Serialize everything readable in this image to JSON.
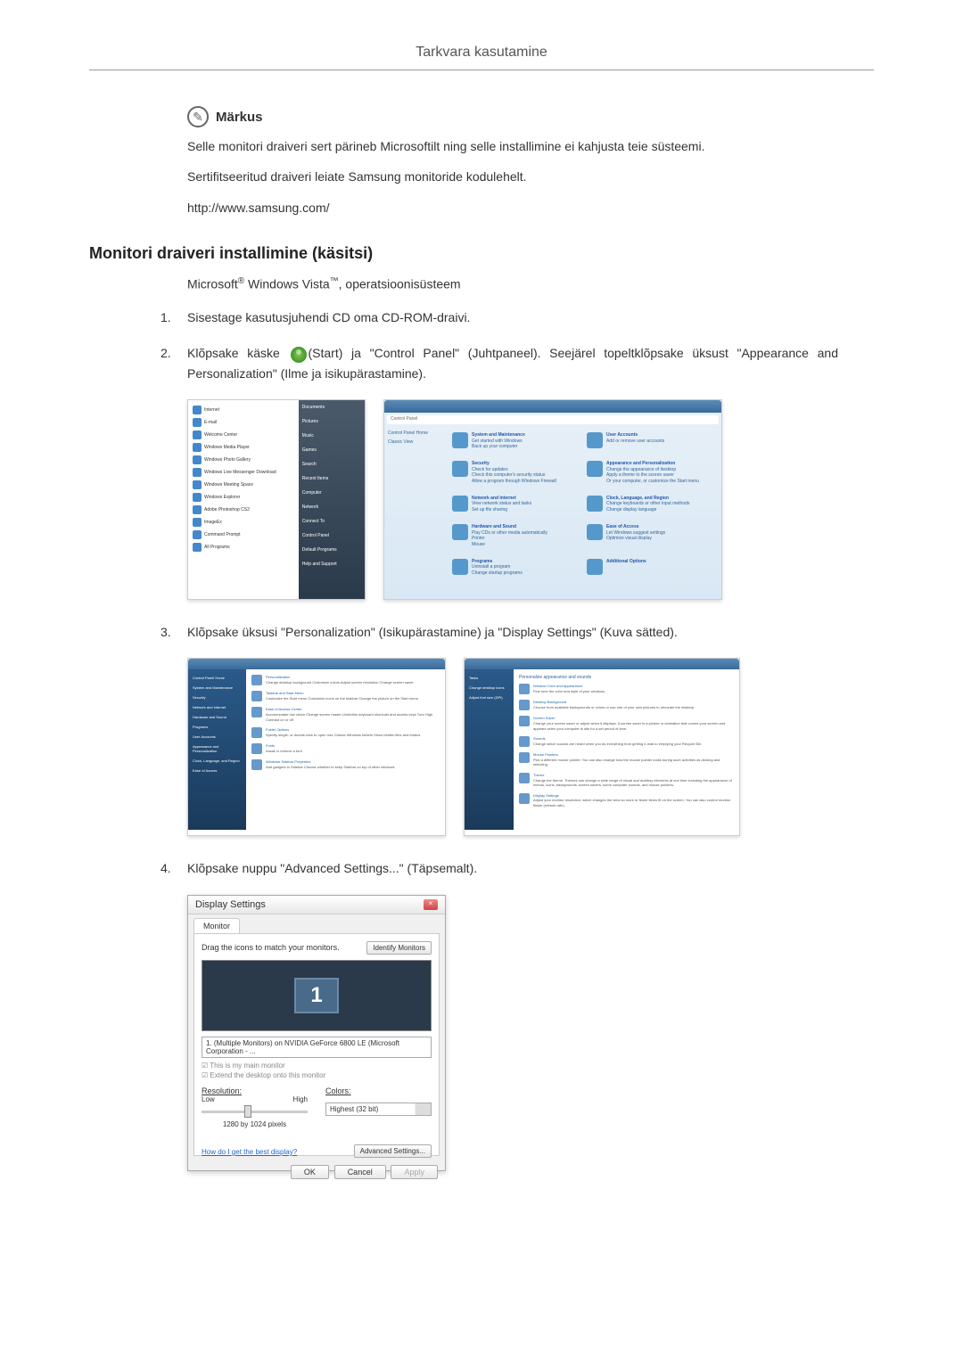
{
  "header": {
    "title": "Tarkvara kasutamine"
  },
  "note": {
    "label": "Märkus",
    "text1": "Selle monitori draiveri sert pärineb Microsoftilt ning selle installimine ei kahjusta teie süsteemi.",
    "text2": "Sertifitseeritud draiveri leiate Samsung monitoride kodulehelt.",
    "text3": "http://www.samsung.com/"
  },
  "section": {
    "heading": "Monitori draiveri installimine (käsitsi)",
    "subheading_prefix": "Microsoft",
    "subheading_mid": " Windows Vista",
    "subheading_suffix": ", operatsioonisüsteem"
  },
  "steps": {
    "step1_num": "1.",
    "step1_text": "Sisestage kasutusjuhendi CD oma CD-ROM-draivi.",
    "step2_num": "2.",
    "step2_prefix": "Klõpsake käske ",
    "step2_suffix": "(Start) ja \"Control Panel\" (Juhtpaneel). Seejärel topeltklõpsake üksust \"Appearance and Personalization\" (Ilme ja isikupärastamine).",
    "step3_num": "3.",
    "step3_text": "Klõpsake üksusi \"Personalization\" (Isikupärastamine) ja \"Display Settings\" (Kuva sätted).",
    "step4_num": "4.",
    "step4_text": "Klõpsake nuppu \"Advanced Settings...\" (Täpsemalt)."
  },
  "start_menu": {
    "items": [
      "Internet",
      "E-mail",
      "Welcome Center",
      "Windows Media Player",
      "Windows Photo Gallery",
      "Windows Live Messenger Download",
      "Windows Meeting Space",
      "Windows Explorer",
      "Adobe Photoshop CS2",
      "ImageEx",
      "Command Prompt",
      "All Programs"
    ],
    "right_items": [
      "Documents",
      "Pictures",
      "Music",
      "Games",
      "Search",
      "Recent Items",
      "Computer",
      "Network",
      "Connect To",
      "Control Panel",
      "Default Programs",
      "Help and Support"
    ]
  },
  "control_panel": {
    "addr": "Control Panel",
    "side": "Control Panel Home",
    "side2": "Classic View",
    "categories": [
      {
        "title": "System and Maintenance",
        "sub": "Get started with Windows\nBack up your computer"
      },
      {
        "title": "User Accounts",
        "sub": "Add or remove user accounts"
      },
      {
        "title": "Security",
        "sub": "Check for updates\nCheck this computer's security status\nAllow a program through Windows Firewall"
      },
      {
        "title": "Appearance and Personalization",
        "sub": "Change the appearance of desktop\nApply a theme to the screen saver\nOr your computer, or customize the Start menu"
      },
      {
        "title": "Network and Internet",
        "sub": "View network status and tasks\nSet up file sharing"
      },
      {
        "title": "Clock, Language, and Region",
        "sub": "Change keyboards or other input methods\nChange display language"
      },
      {
        "title": "Hardware and Sound",
        "sub": "Play CDs or other media automatically\nPrinter\nMouse"
      },
      {
        "title": "Ease of Access",
        "sub": "Let Windows suggest settings\nOptimize visual display"
      },
      {
        "title": "Programs",
        "sub": "Uninstall a program\nChange startup programs"
      },
      {
        "title": "Additional Options",
        "sub": ""
      }
    ]
  },
  "personalization": {
    "side_items": [
      "Control Panel Home",
      "System and Maintenance",
      "Security",
      "Network and Internet",
      "Hardware and Sound",
      "Programs",
      "User Accounts",
      "Appearance and Personalization",
      "Clock, Language, and Region",
      "Ease of Access"
    ],
    "items": [
      {
        "title": "Personalization",
        "sub": "Change desktop background  Customize colors  Adjust screen resolution\nChange screen saver"
      },
      {
        "title": "Taskbar and Start Menu",
        "sub": "Customize the Start menu  Customize icons on the taskbar\nChange the picture on the Start menu"
      },
      {
        "title": "Ease of Access Center",
        "sub": "Accommodate low vision  Change screen reader\nUnderline keyboard shortcuts and access keys  Turn High Contrast on or off"
      },
      {
        "title": "Folder Options",
        "sub": "Specify single- or double-click to open  Use Classic Windows folders\nShow hidden files and folders"
      },
      {
        "title": "Fonts",
        "sub": "Install or remove a font"
      },
      {
        "title": "Windows Sidebar Properties",
        "sub": "Add gadgets to Sidebar  Choose whether to keep Sidebar on top of other windows"
      }
    ]
  },
  "personalization2": {
    "header": "Personalize appearance and sounds",
    "items": [
      {
        "title": "Window Color and Appearance",
        "sub": "Fine tune the color and style of your windows."
      },
      {
        "title": "Desktop Background",
        "sub": "Choose from available backgrounds or colors or use one of your own pictures to decorate the desktop."
      },
      {
        "title": "Screen Saver",
        "sub": "Change your screen saver or adjust when it displays. A screen saver is a picture or animation that covers your screen and appears when your computer is idle for a set period of time."
      },
      {
        "title": "Sounds",
        "sub": "Change which sounds are heard when you do everything from getting e-mail to emptying your Recycle Bin."
      },
      {
        "title": "Mouse Pointers",
        "sub": "Pick a different mouse pointer. You can also change how the mouse pointer looks during such activities as clicking and selecting."
      },
      {
        "title": "Theme",
        "sub": "Change the theme. Themes can change a wide range of visual and auditory elements at one time including the appearance of menus, icons, backgrounds, screen savers, some computer sounds, and mouse pointers."
      },
      {
        "title": "Display Settings",
        "sub": "Adjust your monitor resolution, which changes the view so more or fewer items fit on the screen. You can also control monitor flicker (refresh rate)."
      }
    ]
  },
  "display_settings": {
    "title": "Display Settings",
    "tab": "Monitor",
    "drag_text": "Drag the icons to match your monitors.",
    "identify_btn": "Identify Monitors",
    "monitor_num": "1",
    "monitor_select": "1. (Multiple Monitors) on NVIDIA GeForce 6800 LE (Microsoft Corporation - ...",
    "check1": "This is my main monitor",
    "check2": "Extend the desktop onto this monitor",
    "resolution_label": "Resolution:",
    "res_low": "Low",
    "res_high": "High",
    "res_value": "1280 by 1024 pixels",
    "colors_label": "Colors:",
    "colors_value": "Highest (32 bit)",
    "link": "How do I get the best display?",
    "adv_btn": "Advanced Settings...",
    "ok_btn": "OK",
    "cancel_btn": "Cancel",
    "apply_btn": "Apply"
  }
}
